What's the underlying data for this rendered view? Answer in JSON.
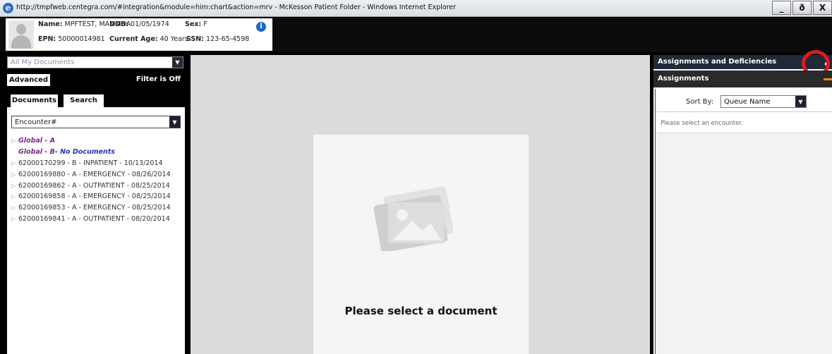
{
  "window": {
    "title": "http://tmpfweb.centegra.com/#integration&module=him:chart&action=mrv - McKesson Patient Folder - Windows Internet Explorer",
    "buttons": {
      "minimize": "_",
      "restore": "ð",
      "close": "X"
    }
  },
  "patient": {
    "name_label": "Name:",
    "name": "MPFTEST, MAMMOA",
    "dob_label": "DOB:",
    "dob": "01/05/1974",
    "sex_label": "Sex:",
    "sex": "F",
    "epn_label": "EPN:",
    "epn": "50000014981",
    "age_label": "Current Age:",
    "age": "40 Years",
    "ssn_label": "SSN:",
    "ssn": "123-65-4598",
    "info_icon": "i"
  },
  "left": {
    "document_filter": "All My Documents",
    "advanced_label": "Advanced",
    "filter_status": "Filter is Off",
    "tabs": [
      "Documents",
      "Search"
    ],
    "group_by": "Encounter#",
    "items": [
      {
        "text": "Global - A",
        "kind": "global"
      },
      {
        "text": "Global - B",
        "suffix": " - No Documents",
        "kind": "global-empty"
      },
      {
        "text": "62000170299 - B - INPATIENT - 10/13/2014",
        "kind": "encounter"
      },
      {
        "text": "62000169880 - A - EMERGENCY - 08/26/2014",
        "kind": "encounter"
      },
      {
        "text": "62000169862 - A - OUTPATIENT - 08/25/2014",
        "kind": "encounter"
      },
      {
        "text": "62000169858 - A - EMERGENCY - 08/25/2014",
        "kind": "encounter"
      },
      {
        "text": "62000169853 - A - EMERGENCY - 08/25/2014",
        "kind": "encounter"
      },
      {
        "text": "62000169841 - A - OUTPATIENT - 08/20/2014",
        "kind": "encounter"
      }
    ]
  },
  "viewer": {
    "placeholder_text": "Please select a document",
    "placeholder_icon": "image-placeholder-icon"
  },
  "right": {
    "header": "Assignments and Deficiencies",
    "collapse_glyph": "▸▸",
    "section": "Assignments",
    "sort_by_label": "Sort By:",
    "sort_by_value": "Queue Name",
    "message": "Please select an encounter."
  },
  "colors": {
    "panel_dark": "#212a38",
    "global_link": "#7b2a86",
    "no_documents": "#2336b4",
    "highlight_circle": "#e01a1a",
    "accent_orange": "#e38b1e"
  }
}
